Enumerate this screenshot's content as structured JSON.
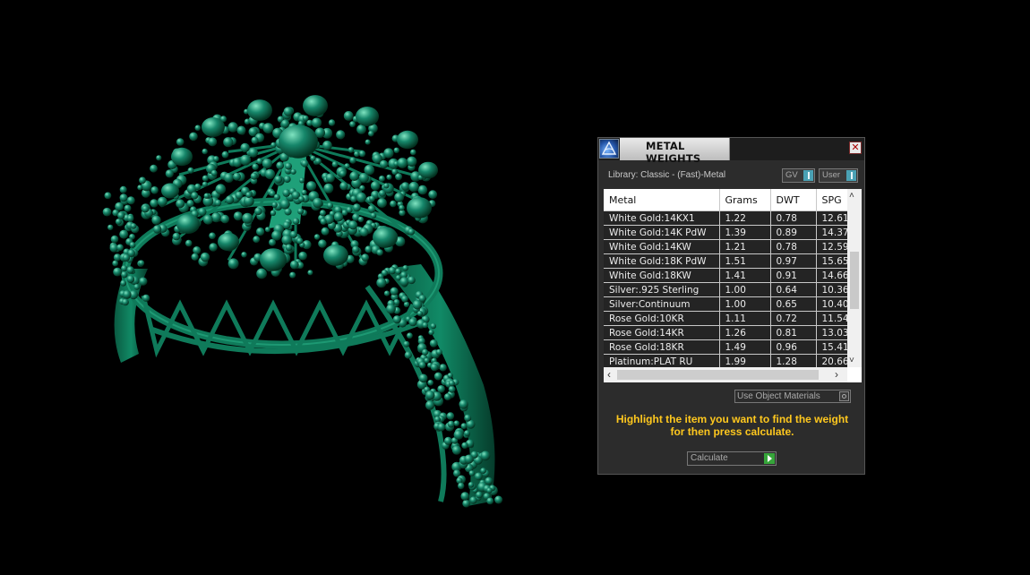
{
  "viewport": {
    "object": "3D ring model"
  },
  "dialog": {
    "title": "METAL WEIGHTS",
    "close_glyph": "✕",
    "library_label": "Library: Classic - (Fast)-Metal",
    "toggle_gv": "GV",
    "toggle_user": "User",
    "columns": [
      "Metal",
      "Grams",
      "DWT",
      "SPG"
    ],
    "rows": [
      [
        "White Gold:14KX1",
        "1.22",
        "0.78",
        "12.61"
      ],
      [
        "White Gold:14K PdW",
        "1.39",
        "0.89",
        "14.37"
      ],
      [
        "White Gold:14KW",
        "1.21",
        "0.78",
        "12.59"
      ],
      [
        "White Gold:18K PdW",
        "1.51",
        "0.97",
        "15.65"
      ],
      [
        "White Gold:18KW",
        "1.41",
        "0.91",
        "14.66"
      ],
      [
        "Silver:.925 Sterling",
        "1.00",
        "0.64",
        "10.36"
      ],
      [
        "Silver:Continuum",
        "1.00",
        "0.65",
        "10.40"
      ],
      [
        "Rose Gold:10KR",
        "1.11",
        "0.72",
        "11.54"
      ],
      [
        "Rose Gold:14KR",
        "1.26",
        "0.81",
        "13.03"
      ],
      [
        "Rose Gold:18KR",
        "1.49",
        "0.96",
        "15.41"
      ],
      [
        "Platinum:PLAT RU",
        "1.99",
        "1.28",
        "20.66"
      ]
    ],
    "use_object_materials": "Use Object Materials",
    "hint": "Highlight the item you want to find the weight for then press calculate.",
    "calculate_label": "Calculate",
    "colors": {
      "hint": "#ffc81e",
      "model": "#0e6e51",
      "accent": "#4aa1b4",
      "go": "#36a53a"
    }
  }
}
